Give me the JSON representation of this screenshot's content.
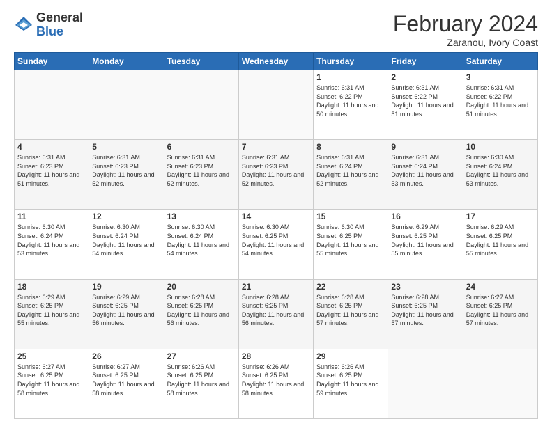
{
  "logo": {
    "general": "General",
    "blue": "Blue"
  },
  "header": {
    "month_year": "February 2024",
    "location": "Zaranou, Ivory Coast"
  },
  "days_of_week": [
    "Sunday",
    "Monday",
    "Tuesday",
    "Wednesday",
    "Thursday",
    "Friday",
    "Saturday"
  ],
  "weeks": [
    [
      {
        "day": "",
        "info": ""
      },
      {
        "day": "",
        "info": ""
      },
      {
        "day": "",
        "info": ""
      },
      {
        "day": "",
        "info": ""
      },
      {
        "day": "1",
        "info": "Sunrise: 6:31 AM\nSunset: 6:22 PM\nDaylight: 11 hours and 50 minutes."
      },
      {
        "day": "2",
        "info": "Sunrise: 6:31 AM\nSunset: 6:22 PM\nDaylight: 11 hours and 51 minutes."
      },
      {
        "day": "3",
        "info": "Sunrise: 6:31 AM\nSunset: 6:22 PM\nDaylight: 11 hours and 51 minutes."
      }
    ],
    [
      {
        "day": "4",
        "info": "Sunrise: 6:31 AM\nSunset: 6:23 PM\nDaylight: 11 hours and 51 minutes."
      },
      {
        "day": "5",
        "info": "Sunrise: 6:31 AM\nSunset: 6:23 PM\nDaylight: 11 hours and 52 minutes."
      },
      {
        "day": "6",
        "info": "Sunrise: 6:31 AM\nSunset: 6:23 PM\nDaylight: 11 hours and 52 minutes."
      },
      {
        "day": "7",
        "info": "Sunrise: 6:31 AM\nSunset: 6:23 PM\nDaylight: 11 hours and 52 minutes."
      },
      {
        "day": "8",
        "info": "Sunrise: 6:31 AM\nSunset: 6:24 PM\nDaylight: 11 hours and 52 minutes."
      },
      {
        "day": "9",
        "info": "Sunrise: 6:31 AM\nSunset: 6:24 PM\nDaylight: 11 hours and 53 minutes."
      },
      {
        "day": "10",
        "info": "Sunrise: 6:30 AM\nSunset: 6:24 PM\nDaylight: 11 hours and 53 minutes."
      }
    ],
    [
      {
        "day": "11",
        "info": "Sunrise: 6:30 AM\nSunset: 6:24 PM\nDaylight: 11 hours and 53 minutes."
      },
      {
        "day": "12",
        "info": "Sunrise: 6:30 AM\nSunset: 6:24 PM\nDaylight: 11 hours and 54 minutes."
      },
      {
        "day": "13",
        "info": "Sunrise: 6:30 AM\nSunset: 6:24 PM\nDaylight: 11 hours and 54 minutes."
      },
      {
        "day": "14",
        "info": "Sunrise: 6:30 AM\nSunset: 6:25 PM\nDaylight: 11 hours and 54 minutes."
      },
      {
        "day": "15",
        "info": "Sunrise: 6:30 AM\nSunset: 6:25 PM\nDaylight: 11 hours and 55 minutes."
      },
      {
        "day": "16",
        "info": "Sunrise: 6:29 AM\nSunset: 6:25 PM\nDaylight: 11 hours and 55 minutes."
      },
      {
        "day": "17",
        "info": "Sunrise: 6:29 AM\nSunset: 6:25 PM\nDaylight: 11 hours and 55 minutes."
      }
    ],
    [
      {
        "day": "18",
        "info": "Sunrise: 6:29 AM\nSunset: 6:25 PM\nDaylight: 11 hours and 55 minutes."
      },
      {
        "day": "19",
        "info": "Sunrise: 6:29 AM\nSunset: 6:25 PM\nDaylight: 11 hours and 56 minutes."
      },
      {
        "day": "20",
        "info": "Sunrise: 6:28 AM\nSunset: 6:25 PM\nDaylight: 11 hours and 56 minutes."
      },
      {
        "day": "21",
        "info": "Sunrise: 6:28 AM\nSunset: 6:25 PM\nDaylight: 11 hours and 56 minutes."
      },
      {
        "day": "22",
        "info": "Sunrise: 6:28 AM\nSunset: 6:25 PM\nDaylight: 11 hours and 57 minutes."
      },
      {
        "day": "23",
        "info": "Sunrise: 6:28 AM\nSunset: 6:25 PM\nDaylight: 11 hours and 57 minutes."
      },
      {
        "day": "24",
        "info": "Sunrise: 6:27 AM\nSunset: 6:25 PM\nDaylight: 11 hours and 57 minutes."
      }
    ],
    [
      {
        "day": "25",
        "info": "Sunrise: 6:27 AM\nSunset: 6:25 PM\nDaylight: 11 hours and 58 minutes."
      },
      {
        "day": "26",
        "info": "Sunrise: 6:27 AM\nSunset: 6:25 PM\nDaylight: 11 hours and 58 minutes."
      },
      {
        "day": "27",
        "info": "Sunrise: 6:26 AM\nSunset: 6:25 PM\nDaylight: 11 hours and 58 minutes."
      },
      {
        "day": "28",
        "info": "Sunrise: 6:26 AM\nSunset: 6:25 PM\nDaylight: 11 hours and 58 minutes."
      },
      {
        "day": "29",
        "info": "Sunrise: 6:26 AM\nSunset: 6:25 PM\nDaylight: 11 hours and 59 minutes."
      },
      {
        "day": "",
        "info": ""
      },
      {
        "day": "",
        "info": ""
      }
    ]
  ]
}
